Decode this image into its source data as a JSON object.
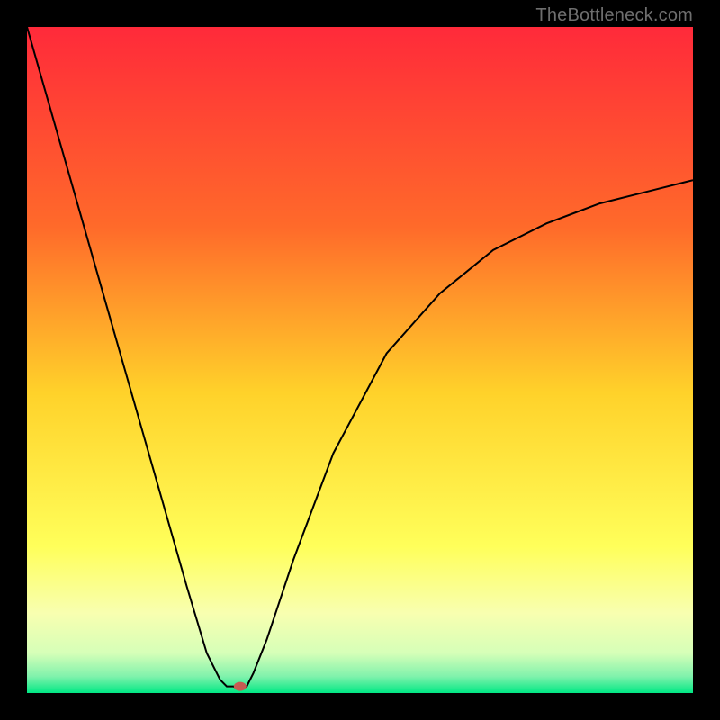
{
  "watermark": "TheBottleneck.com",
  "chart_data": {
    "type": "line",
    "title": "",
    "xlabel": "",
    "ylabel": "",
    "xlim": [
      0,
      100
    ],
    "ylim": [
      0,
      100
    ],
    "grid": false,
    "legend": false,
    "annotations": [
      {
        "kind": "marker",
        "x": 32,
        "y": 1,
        "color": "#c75a52",
        "size": 8
      }
    ],
    "background_gradient": {
      "stops": [
        {
          "offset": 0.0,
          "color": "#ff2a3a"
        },
        {
          "offset": 0.3,
          "color": "#ff6a2a"
        },
        {
          "offset": 0.55,
          "color": "#ffd22a"
        },
        {
          "offset": 0.78,
          "color": "#ffff5a"
        },
        {
          "offset": 0.88,
          "color": "#f8ffb0"
        },
        {
          "offset": 0.94,
          "color": "#d6ffb8"
        },
        {
          "offset": 0.975,
          "color": "#80f2ac"
        },
        {
          "offset": 1.0,
          "color": "#00e884"
        }
      ]
    },
    "series": [
      {
        "name": "curve",
        "color": "#000000",
        "width": 2,
        "x": [
          0,
          4,
          8,
          12,
          16,
          20,
          24,
          27,
          29,
          30,
          31,
          32,
          33,
          34,
          36,
          40,
          46,
          54,
          62,
          70,
          78,
          86,
          94,
          100
        ],
        "y": [
          100,
          86,
          72,
          58,
          44,
          30,
          16,
          6,
          2,
          1,
          1,
          0.5,
          1,
          3,
          8,
          20,
          36,
          51,
          60,
          66.5,
          70.5,
          73.5,
          75.5,
          77
        ]
      }
    ]
  }
}
